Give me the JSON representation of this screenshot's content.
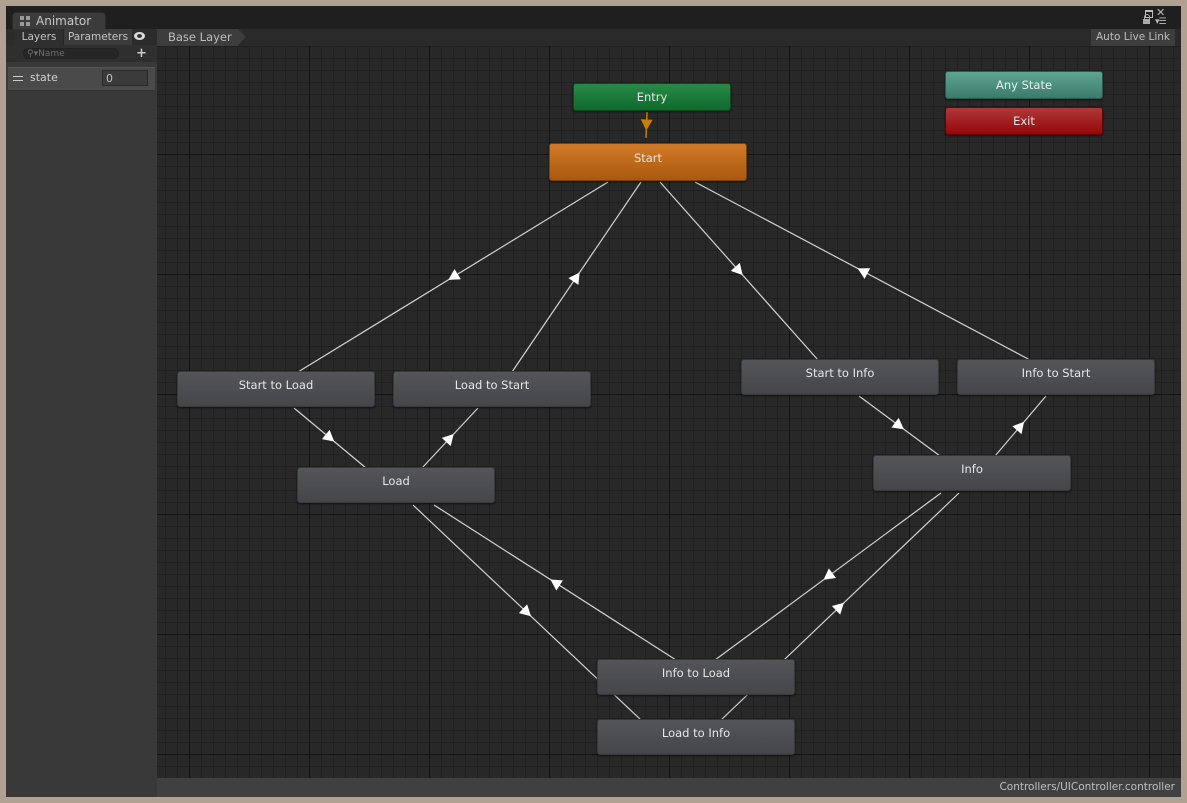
{
  "window": {
    "tab_title": "Animator",
    "icons": [
      "animator-icon",
      "maximize-icon",
      "close-icon",
      "lock-icon",
      "menu-icon"
    ]
  },
  "left_panel": {
    "tabs": [
      {
        "label": "Layers",
        "active": false
      },
      {
        "label": "Parameters",
        "active": true
      }
    ],
    "eye_icon": "eye-icon",
    "search": {
      "placeholder": "Name",
      "value": ""
    },
    "add_button_label": "+",
    "parameters": [
      {
        "name": "state",
        "value": "0",
        "type": "int"
      }
    ]
  },
  "toolbar": {
    "breadcrumb": "Base Layer",
    "auto_live_link_label": "Auto Live Link"
  },
  "graph": {
    "nodes": [
      {
        "id": "entry",
        "label": "Entry",
        "kind": "entry",
        "color": "#1a7a3a"
      },
      {
        "id": "start",
        "label": "Start",
        "kind": "default-state",
        "color": "#c06a1c"
      },
      {
        "id": "any",
        "label": "Any State",
        "kind": "any-state",
        "color": "#4b9080"
      },
      {
        "id": "exit",
        "label": "Exit",
        "kind": "exit",
        "color": "#a01818"
      },
      {
        "id": "s2l",
        "label": "Start to Load",
        "kind": "state"
      },
      {
        "id": "l2s",
        "label": "Load to Start",
        "kind": "state"
      },
      {
        "id": "s2i",
        "label": "Start to Info",
        "kind": "state"
      },
      {
        "id": "i2s",
        "label": "Info to Start",
        "kind": "state"
      },
      {
        "id": "load",
        "label": "Load",
        "kind": "state"
      },
      {
        "id": "info",
        "label": "Info",
        "kind": "state"
      },
      {
        "id": "i2l",
        "label": "Info to Load",
        "kind": "state"
      },
      {
        "id": "l2i",
        "label": "Load to Info",
        "kind": "state"
      }
    ],
    "transitions": [
      {
        "from": "entry",
        "to": "start",
        "color": "#c87f0a"
      },
      {
        "from": "start",
        "to": "s2l"
      },
      {
        "from": "l2s",
        "to": "start"
      },
      {
        "from": "start",
        "to": "s2i"
      },
      {
        "from": "i2s",
        "to": "start"
      },
      {
        "from": "s2l",
        "to": "load"
      },
      {
        "from": "load",
        "to": "l2s"
      },
      {
        "from": "s2i",
        "to": "info"
      },
      {
        "from": "info",
        "to": "i2s"
      },
      {
        "from": "load",
        "to": "l2i"
      },
      {
        "from": "i2l",
        "to": "load"
      },
      {
        "from": "info",
        "to": "i2l"
      },
      {
        "from": "l2i",
        "to": "info"
      }
    ]
  },
  "status_bar": {
    "controller_path": "Controllers/UIController.controller"
  }
}
